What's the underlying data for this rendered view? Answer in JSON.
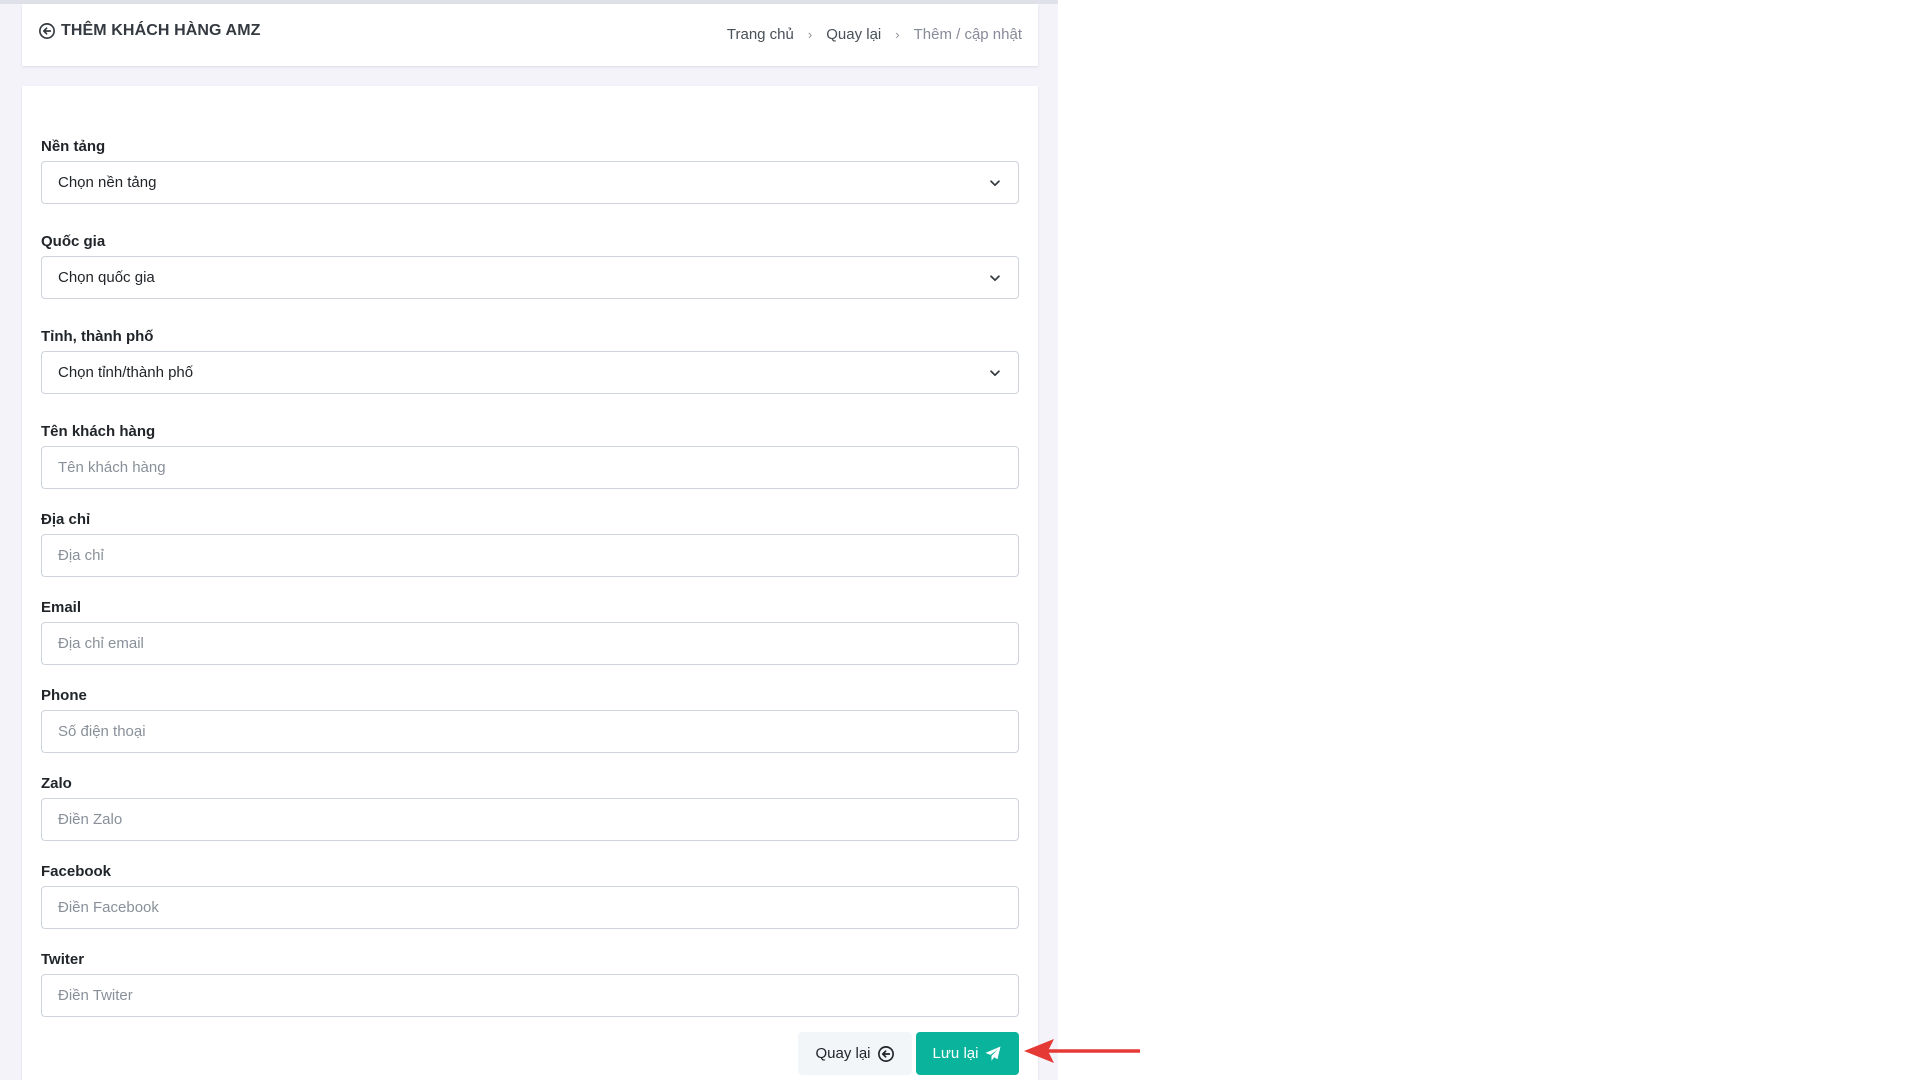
{
  "header": {
    "title": "THÊM KHÁCH HÀNG AMZ",
    "breadcrumb": [
      "Trang chủ",
      "Quay lại",
      "Thêm / cập nhật"
    ]
  },
  "form": {
    "platform": {
      "label": "Nền tảng",
      "selected": "Chọn nền tảng"
    },
    "country": {
      "label": "Quốc gia",
      "selected": "Chọn quốc gia"
    },
    "city": {
      "label": "Tỉnh, thành phố",
      "selected": "Chọn tỉnh/thành phố"
    },
    "customer_name": {
      "label": "Tên khách hàng",
      "placeholder": "Tên khách hàng"
    },
    "address": {
      "label": "Địa chỉ",
      "placeholder": "Địa chỉ"
    },
    "email": {
      "label": "Email",
      "placeholder": "Địa chỉ email"
    },
    "phone": {
      "label": "Phone",
      "placeholder": "Số điện thoại"
    },
    "zalo": {
      "label": "Zalo",
      "placeholder": "Điền Zalo"
    },
    "facebook": {
      "label": "Facebook",
      "placeholder": "Điền Facebook"
    },
    "twitter": {
      "label": "Twiter",
      "placeholder": "Điền Twiter"
    }
  },
  "actions": {
    "back_label": "Quay lại",
    "save_label": "Lưu lại"
  },
  "colors": {
    "accent": "#0ab39c",
    "annotation": "#e53935"
  },
  "icons": {
    "title": "arrow-circle-left-icon",
    "back": "arrow-circle-left-icon",
    "save": "paper-plane-icon",
    "select": "chevron-down-icon"
  }
}
